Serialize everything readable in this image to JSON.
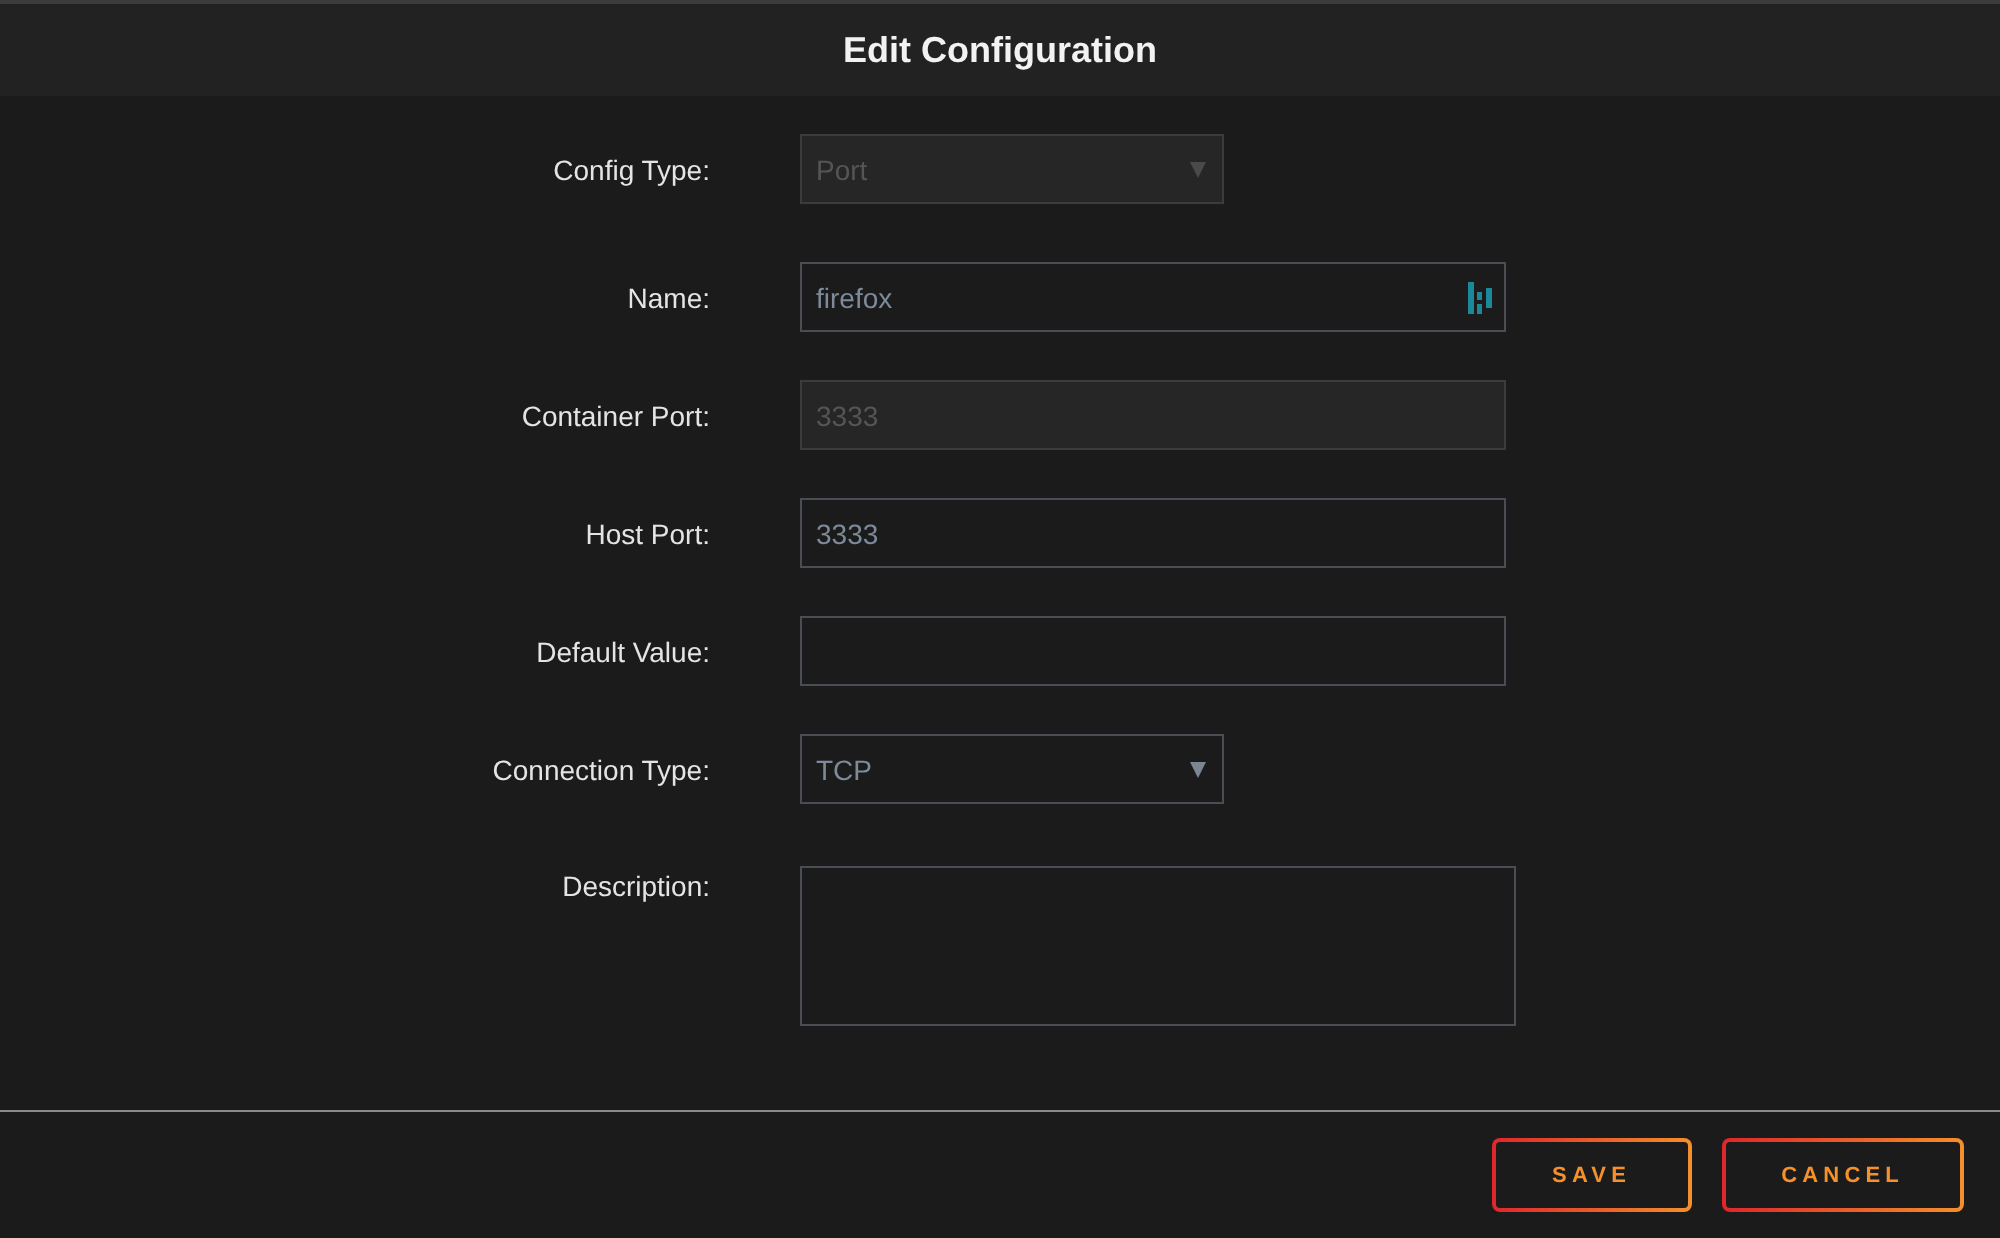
{
  "dialog": {
    "title": "Edit Configuration"
  },
  "fields": [
    {
      "label": "Config Type:",
      "kind": "select",
      "value": "Port",
      "disabled": true
    },
    {
      "label": "Name:",
      "kind": "input",
      "value": "firefox",
      "disabled": false,
      "has_icon": true
    },
    {
      "label": "Container Port:",
      "kind": "input",
      "value": "3333",
      "disabled": true
    },
    {
      "label": "Host Port:",
      "kind": "input",
      "value": "3333",
      "disabled": false
    },
    {
      "label": "Default Value:",
      "kind": "input",
      "disabled": false
    },
    {
      "label": "Connection Type:",
      "kind": "select",
      "value": "TCP",
      "disabled": false
    },
    {
      "label": "Description:",
      "kind": "textarea",
      "disabled": false
    }
  ],
  "buttons": [
    {
      "label": "SAVE"
    },
    {
      "label": "CANCEL"
    }
  ]
}
